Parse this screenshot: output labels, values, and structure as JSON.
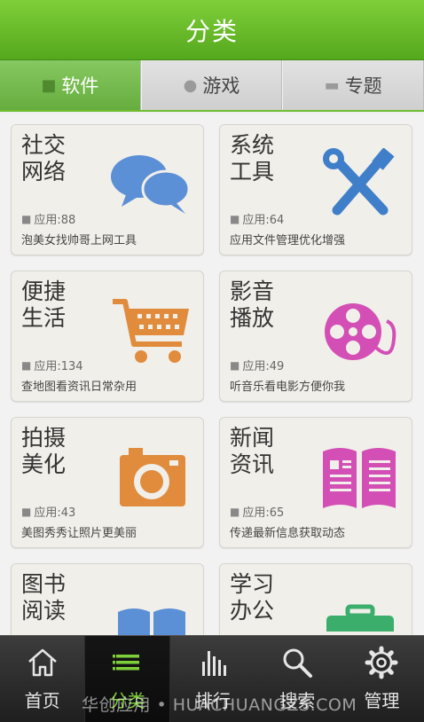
{
  "title": "分类",
  "tabs": [
    {
      "label": "软件",
      "icon": "cube-icon",
      "active": true
    },
    {
      "label": "游戏",
      "icon": "gamepad-icon",
      "active": false
    },
    {
      "label": "专题",
      "icon": "book-icon",
      "active": false
    }
  ],
  "categories": [
    {
      "name": "社交\n网络",
      "count": "应用:88",
      "desc": "泡美女找帅哥上网工具",
      "icon": "chat-bubbles-icon",
      "color": "#5b8fd6"
    },
    {
      "name": "系统\n工具",
      "count": "应用:64",
      "desc": "应用文件管理优化增强",
      "icon": "tools-icon",
      "color": "#3f7fc9"
    },
    {
      "name": "便捷\n生活",
      "count": "应用:134",
      "desc": "查地图看资讯日常杂用",
      "icon": "shopping-cart-icon",
      "color": "#e08c3c"
    },
    {
      "name": "影音\n播放",
      "count": "应用:49",
      "desc": "听音乐看电影方便你我",
      "icon": "film-reel-icon",
      "color": "#d34fb5"
    },
    {
      "name": "拍摄\n美化",
      "count": "应用:43",
      "desc": "美图秀秀让照片更美丽",
      "icon": "camera-icon",
      "color": "#e08c3c"
    },
    {
      "name": "新闻\n资讯",
      "count": "应用:65",
      "desc": "传递最新信息获取动态",
      "icon": "newspaper-icon",
      "color": "#d34fb5"
    },
    {
      "name": "图书\n阅读",
      "count": "",
      "desc": "",
      "icon": "open-book-icon",
      "color": "#5b8fd6"
    },
    {
      "name": "学习\n办公",
      "count": "",
      "desc": "",
      "icon": "briefcase-icon",
      "color": "#3cae6b"
    }
  ],
  "bottom_nav": [
    {
      "label": "首页",
      "icon": "home-icon"
    },
    {
      "label": "分类",
      "icon": "list-icon",
      "active": true
    },
    {
      "label": "排行",
      "icon": "bar-chart-icon"
    },
    {
      "label": "搜索",
      "icon": "search-icon"
    },
    {
      "label": "管理",
      "icon": "gear-icon"
    }
  ],
  "watermark": "华创应用 • HUACHUANGZS.COM",
  "colors": {
    "accent": "#6fbd2f",
    "nav_active": "#7fcf39"
  }
}
